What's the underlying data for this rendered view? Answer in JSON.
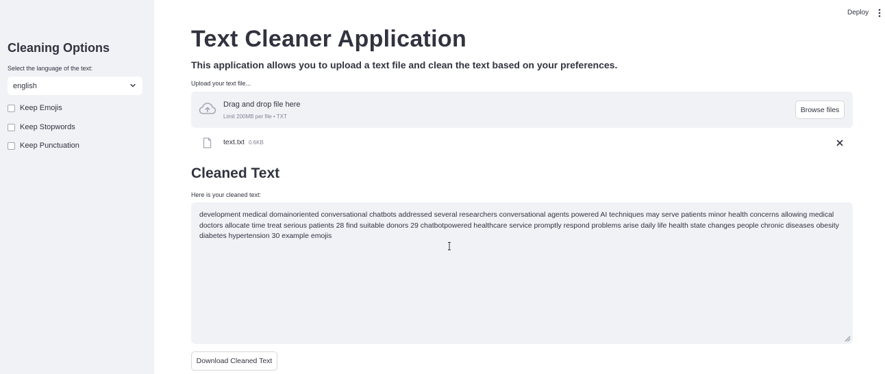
{
  "header": {
    "deploy_label": "Deploy",
    "menu_icon": "vertical-dots-icon"
  },
  "sidebar": {
    "title": "Cleaning Options",
    "language_label": "Select the language of the text:",
    "language_value": "english",
    "checkboxes": [
      {
        "label": "Keep Emojis",
        "checked": false
      },
      {
        "label": "Keep Stopwords",
        "checked": false
      },
      {
        "label": "Keep Punctuation",
        "checked": false
      }
    ]
  },
  "main": {
    "title": "Text Cleaner Application",
    "subtitle": "This application allows you to upload a text file and clean the text based on your preferences.",
    "uploader": {
      "label": "Upload your text file...",
      "drop_text": "Drag and drop file here",
      "limit_text": "Limit 200MB per file • TXT",
      "browse_label": "Browse files",
      "icon": "cloud-upload-icon"
    },
    "uploaded_file": {
      "name": "text.txt",
      "size": "0.6KB",
      "icon": "file-icon"
    },
    "cleaned": {
      "section_title": "Cleaned Text",
      "label": "Here is your cleaned text:",
      "text": "development medical domainoriented conversational chatbots addressed several researchers conversational agents powered AI techniques may serve patients minor health concerns allowing medical doctors allocate time treat serious patients 28 find suitable donors 29 chatbotpowered healthcare service promptly respond problems arise daily life health state changes people chronic diseases obesity diabetes hypertension 30 example emojis"
    },
    "download_label": "Download Cleaned Text"
  },
  "colors": {
    "sidebar_bg": "#f0f2f6",
    "text": "#31333f",
    "muted": "#808495",
    "border": "#d5d7dc"
  }
}
